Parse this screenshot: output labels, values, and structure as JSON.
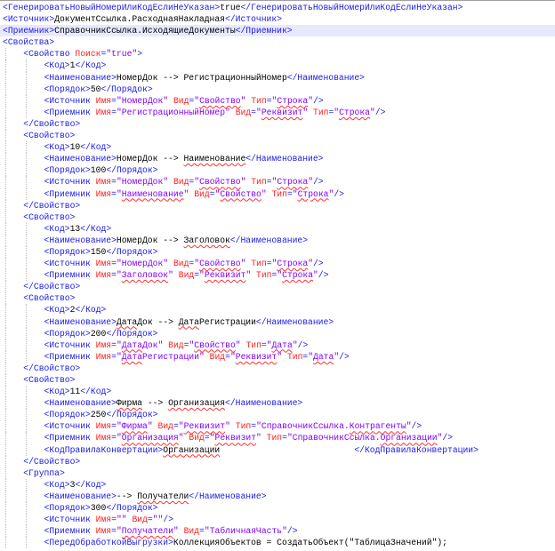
{
  "editor": {
    "current_line": 3,
    "misspelled_words": [
      "Свойство",
      "Строка",
      "Реквизит",
      "Наименование",
      "Заголовок",
      "Дата",
      "Фирма",
      "Организация",
      "Контрагенты",
      "Организации",
      "Получатели"
    ],
    "colors": {
      "tag": "#1a1ae6",
      "attribute": "#ff2020",
      "value": "#8000ff",
      "text": "#000000",
      "current_line": "#e8e8ff"
    },
    "lines": [
      "<ГенерироватьНовыйНомерИлиКодЕслиНеУказан>true</ГенерироватьНовыйНомерИлиКодЕслиНеУказан>",
      "<Источник>ДокументСсылка.РасходнаяНакладная</Источник>",
      "<Приемник>СправочникСсылка.ИсходящиеДокументы</Приемник>",
      "<Свойства>",
      "    <Свойство Поиск=\"true\">",
      "        <Код>1</Код>",
      "        <Наименование>НомерДок --&gt; РегистрационныйНомер</Наименование>",
      "        <Порядок>50</Порядок>",
      "        <Источник Имя=\"НомерДок\" Вид=\"Свойство\" Тип=\"Строка\"/>",
      "        <Приемник Имя=\"РегистрационныйНомер\" Вид=\"Реквизит\" Тип=\"Строка\"/>",
      "    </Свойство>",
      "    <Свойство>",
      "        <Код>10</Код>",
      "        <Наименование>НомерДок --&gt; Наименование</Наименование>",
      "        <Порядок>100</Порядок>",
      "        <Источник Имя=\"НомерДок\" Вид=\"Свойство\" Тип=\"Строка\"/>",
      "        <Приемник Имя=\"Наименование\" Вид=\"Свойство\" Тип=\"Строка\"/>",
      "    </Свойство>",
      "    <Свойство>",
      "        <Код>13</Код>",
      "        <Наименование>НомерДок --&gt; Заголовок</Наименование>",
      "        <Порядок>150</Порядок>",
      "        <Источник Имя=\"НомерДок\" Вид=\"Свойство\" Тип=\"Строка\"/>",
      "        <Приемник Имя=\"Заголовок\" Вид=\"Реквизит\" Тип=\"Строка\"/>",
      "    </Свойство>",
      "    <Свойство>",
      "        <Код>2</Код>",
      "        <Наименование>ДатаДок --&gt; ДатаРегистрации</Наименование>",
      "        <Порядок>200</Порядок>",
      "        <Источник Имя=\"ДатаДок\" Вид=\"Свойство\" Тип=\"Дата\"/>",
      "        <Приемник Имя=\"ДатаРегистрации\" Вид=\"Реквизит\" Тип=\"Дата\"/>",
      "    </Свойство>",
      "    <Свойство>",
      "        <Код>11</Код>",
      "        <Наименование>Фирма --&gt; Организация</Наименование>",
      "        <Порядок>250</Порядок>",
      "        <Источник Имя=\"Фирма\" Вид=\"Реквизит\" Тип=\"СправочникСсылка.Контрагенты\"/>",
      "        <Приемник Имя=\"Организация\" Вид=\"Реквизит\" Тип=\"СправочникСсылка.Организации\"/>",
      "        <КодПравилаКонвертации>Организации                          </КодПравилаКонвертации>",
      "    </Свойство>",
      "    <Группа>",
      "        <Код>3</Код>",
      "        <Наименование>--&gt; Получатели</Наименование>",
      "        <Порядок>300</Порядок>",
      "        <Источник Имя=\"\" Вид=\"\"/>",
      "        <Приемник Имя=\"Получатели\" Вид=\"ТабличнаяЧасть\"/>",
      "        <ПередОбработкойВыгрузки>КоллекцияОбъектов = СоздатьОбъект(\"ТаблицаЗначений\");"
    ]
  }
}
